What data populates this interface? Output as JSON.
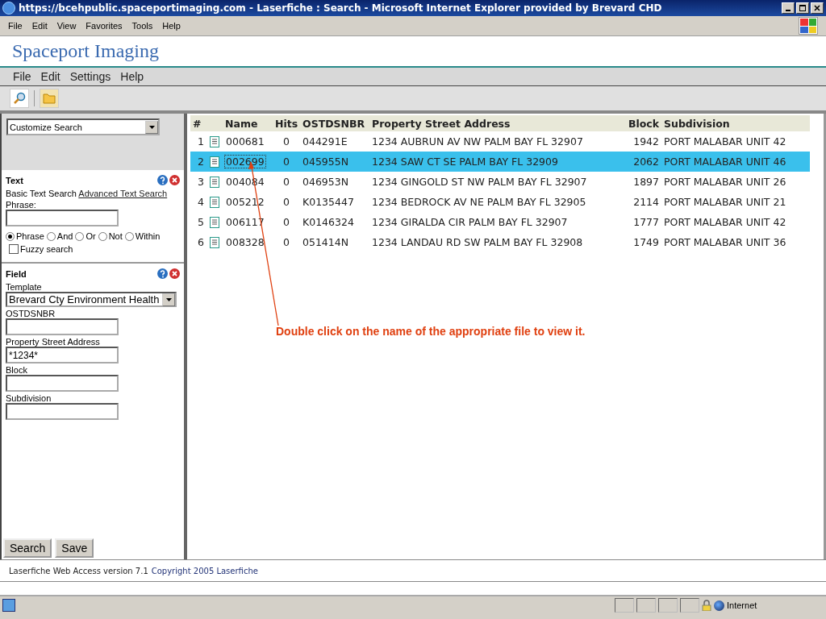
{
  "window": {
    "title": "https://bcehpublic.spaceportimaging.com - Laserfiche : Search - Microsoft Internet Explorer provided by Brevard CHD"
  },
  "browser_menu": [
    "File",
    "Edit",
    "View",
    "Favorites",
    "Tools",
    "Help"
  ],
  "site_title": "Spaceport Imaging",
  "app_menu": [
    "File",
    "Edit",
    "Settings",
    "Help"
  ],
  "sidebar": {
    "customize": "Customize Search",
    "text_section": {
      "title": "Text",
      "basic": "Basic Text Search",
      "advanced": "Advanced Text Search",
      "phrase_label": "Phrase:",
      "modes": [
        {
          "label": "Phrase",
          "selected": true
        },
        {
          "label": "And",
          "selected": false
        },
        {
          "label": "Or",
          "selected": false
        },
        {
          "label": "Not",
          "selected": false
        },
        {
          "label": "Within",
          "selected": false
        }
      ],
      "fuzzy": {
        "label": "Fuzzy search",
        "checked": false
      }
    },
    "field_section": {
      "title": "Field",
      "template_label": "Template",
      "template": "Brevard Cty Environment Health",
      "fields": [
        {
          "label": "OSTDSNBR"
        },
        {
          "label": "Property Street Address",
          "value": "*1234*"
        },
        {
          "label": "Block"
        },
        {
          "label": "Subdivision"
        }
      ]
    },
    "buttons": [
      "Search",
      "Save"
    ]
  },
  "table": {
    "columns": [
      "#",
      "Name",
      "Hits",
      "OSTDSNBR",
      "Property Street Address",
      "Block",
      "Subdivision"
    ],
    "rows": [
      {
        "num": "1",
        "name": "000681",
        "hits": "0",
        "ostdsnbr": "044291E",
        "address": "1234 AUBRUN AV NW PALM BAY FL 32907",
        "block": "1942",
        "subdivision": "PORT MALABAR UNIT 42",
        "selected": false
      },
      {
        "num": "2",
        "name": "002699",
        "hits": "0",
        "ostdsnbr": "045955N",
        "address": "1234 SAW CT SE PALM BAY FL 32909",
        "block": "2062",
        "subdivision": "PORT MALABAR UNIT 46",
        "selected": true
      },
      {
        "num": "3",
        "name": "004084",
        "hits": "0",
        "ostdsnbr": "046953N",
        "address": "1234 GINGOLD ST NW PALM BAY FL 32907",
        "block": "1897",
        "subdivision": "PORT MALABAR UNIT 26",
        "selected": false
      },
      {
        "num": "4",
        "name": "005212",
        "hits": "0",
        "ostdsnbr": "K0135447",
        "address": "1234 BEDROCK AV NE PALM BAY FL 32905",
        "block": "2114",
        "subdivision": "PORT MALABAR UNIT 21",
        "selected": false
      },
      {
        "num": "5",
        "name": "006117",
        "hits": "0",
        "ostdsnbr": "K0146324",
        "address": "1234 GIRALDA CIR PALM BAY FL 32907",
        "block": "1777",
        "subdivision": "PORT MALABAR UNIT 42",
        "selected": false
      },
      {
        "num": "6",
        "name": "008328",
        "hits": "0",
        "ostdsnbr": "051414N",
        "address": "1234 LANDAU RD SW PALM BAY FL 32908",
        "block": "1749",
        "subdivision": "PORT MALABAR UNIT 36",
        "selected": false
      }
    ]
  },
  "annotation": "Double click on the name of the appropriate file to view it.",
  "footer": {
    "version": "Laserfiche Web Access version 7.1",
    "copyright": "Copyright 2005 Laserfiche"
  },
  "status_bar": {
    "zone": "Internet"
  }
}
